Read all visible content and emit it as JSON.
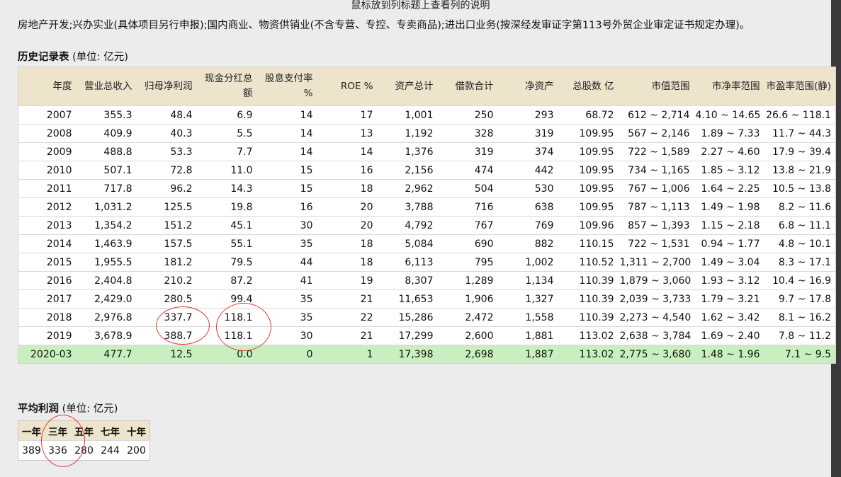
{
  "hint": "鼠标放到列标题上查看列的说明",
  "business_scope": "房地产开发;兴办实业(具体项目另行申报);国内商业、物资供销业(不含专营、专控、专卖商品);进出口业务(按深经发审证字第113号外贸企业审定证书规定办理)。",
  "history": {
    "title_bold": "历史记录表",
    "title_unit": "(单位: 亿元)",
    "headers": [
      "年度",
      "营业总收入",
      "归母净利润",
      "现金分红总额",
      "股息支付率 %",
      "ROE %",
      "资产总计",
      "借款合计",
      "净资产",
      "总股数 亿",
      "市值范围",
      "市净率范围",
      "市盈率范围(静)"
    ],
    "rows": [
      [
        "2007",
        "355.3",
        "48.4",
        "6.9",
        "14",
        "17",
        "1,001",
        "250",
        "293",
        "68.72",
        "612 ~ 2,714",
        "4.10 ~ 14.65",
        "26.6 ~ 118.1"
      ],
      [
        "2008",
        "409.9",
        "40.3",
        "5.5",
        "14",
        "13",
        "1,192",
        "328",
        "319",
        "109.95",
        "567 ~ 2,146",
        "1.89 ~ 7.33",
        "11.7 ~ 44.3"
      ],
      [
        "2009",
        "488.8",
        "53.3",
        "7.7",
        "14",
        "14",
        "1,376",
        "319",
        "374",
        "109.95",
        "722 ~ 1,589",
        "2.27 ~ 4.60",
        "17.9 ~ 39.4"
      ],
      [
        "2010",
        "507.1",
        "72.8",
        "11.0",
        "15",
        "16",
        "2,156",
        "474",
        "442",
        "109.95",
        "734 ~ 1,165",
        "1.85 ~ 3.12",
        "13.8 ~ 21.9"
      ],
      [
        "2011",
        "717.8",
        "96.2",
        "14.3",
        "15",
        "18",
        "2,962",
        "504",
        "530",
        "109.95",
        "767 ~ 1,006",
        "1.64 ~ 2.25",
        "10.5 ~ 13.8"
      ],
      [
        "2012",
        "1,031.2",
        "125.5",
        "19.8",
        "16",
        "20",
        "3,788",
        "716",
        "638",
        "109.95",
        "787 ~ 1,113",
        "1.49 ~ 1.98",
        "8.2 ~ 11.6"
      ],
      [
        "2013",
        "1,354.2",
        "151.2",
        "45.1",
        "30",
        "20",
        "4,792",
        "767",
        "769",
        "109.96",
        "857 ~ 1,393",
        "1.15 ~ 2.18",
        "6.8 ~ 11.1"
      ],
      [
        "2014",
        "1,463.9",
        "157.5",
        "55.1",
        "35",
        "18",
        "5,084",
        "690",
        "882",
        "110.15",
        "722 ~ 1,531",
        "0.94 ~ 1.77",
        "4.8 ~ 10.1"
      ],
      [
        "2015",
        "1,955.5",
        "181.2",
        "79.5",
        "44",
        "18",
        "6,113",
        "795",
        "1,002",
        "110.52",
        "1,311 ~ 2,700",
        "1.49 ~ 3.04",
        "8.3 ~ 17.1"
      ],
      [
        "2016",
        "2,404.8",
        "210.2",
        "87.2",
        "41",
        "19",
        "8,307",
        "1,289",
        "1,134",
        "110.39",
        "1,879 ~ 3,060",
        "1.93 ~ 3.12",
        "10.4 ~ 16.9"
      ],
      [
        "2017",
        "2,429.0",
        "280.5",
        "99.4",
        "35",
        "21",
        "11,653",
        "1,906",
        "1,327",
        "110.39",
        "2,039 ~ 3,733",
        "1.79 ~ 3.21",
        "9.7 ~ 17.8"
      ],
      [
        "2018",
        "2,976.8",
        "337.7",
        "118.1",
        "35",
        "22",
        "15,286",
        "2,472",
        "1,558",
        "110.39",
        "2,273 ~ 4,540",
        "1.62 ~ 3.42",
        "8.1 ~ 16.2"
      ],
      [
        "2019",
        "3,678.9",
        "388.7",
        "118.1",
        "30",
        "21",
        "17,299",
        "2,600",
        "1,881",
        "113.02",
        "2,638 ~ 3,784",
        "1.69 ~ 2.40",
        "7.8 ~ 11.2"
      ],
      [
        "2020-03",
        "477.7",
        "12.5",
        "0.0",
        "0",
        "1",
        "17,398",
        "2,698",
        "1,887",
        "113.02",
        "2,775 ~ 3,680",
        "1.48 ~ 1.96",
        "7.1 ~ 9.5"
      ]
    ]
  },
  "avg_profit": {
    "title_bold": "平均利润",
    "title_unit": "(单位: 亿元)",
    "headers": [
      "一年",
      "三年",
      "五年",
      "七年",
      "十年"
    ],
    "values": [
      "389",
      "336",
      "280",
      "244",
      "200"
    ]
  },
  "colors": {
    "header_bg": "#eee3cb",
    "highlight_row": "#c9efc0",
    "annotation_circle": "#e53935"
  }
}
